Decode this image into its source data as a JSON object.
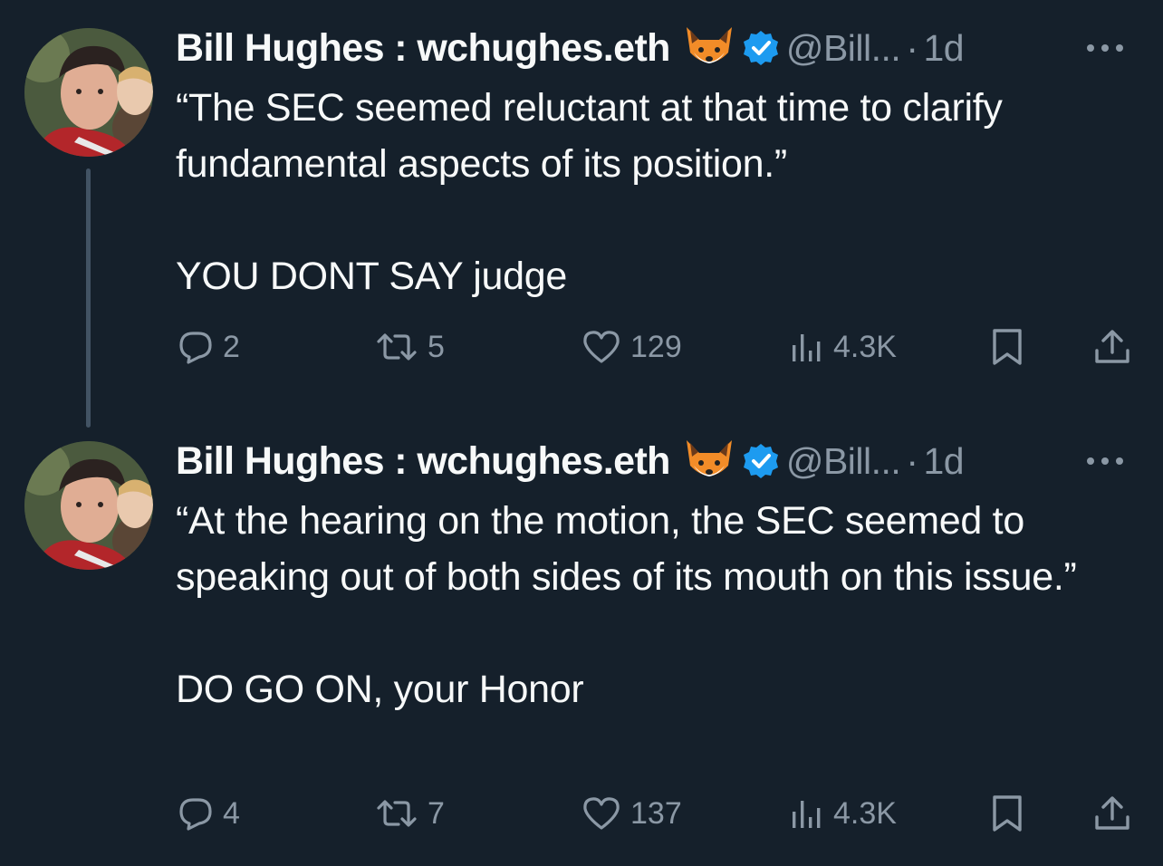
{
  "tweets": [
    {
      "display_name": "Bill Hughes : wchughes.eth",
      "fox_emoji": "fox-face-icon",
      "handle": "@Bill...",
      "separator": "·",
      "time": "1d",
      "body": "“The SEC seemed reluctant at that time to clarify fundamental aspects of its position.”\n\nYOU DONT SAY judge",
      "counts": {
        "replies": "2",
        "retweets": "5",
        "likes": "129",
        "views": "4.3K"
      }
    },
    {
      "display_name": "Bill Hughes : wchughes.eth",
      "fox_emoji": "fox-face-icon",
      "handle": "@Bill...",
      "separator": "·",
      "time": "1d",
      "body": "“At the hearing on the motion, the SEC seemed to speaking out of both sides of its mouth on this issue.”\n\nDO GO ON, your Honor",
      "counts": {
        "replies": "4",
        "retweets": "7",
        "likes": "137",
        "views": "4.3K"
      }
    }
  ],
  "colors": {
    "background": "#15202b",
    "primary_text": "#f7f9f9",
    "secondary_text": "#8b98a5",
    "verified_blue": "#1d9bf0",
    "thread_line": "#425364"
  }
}
